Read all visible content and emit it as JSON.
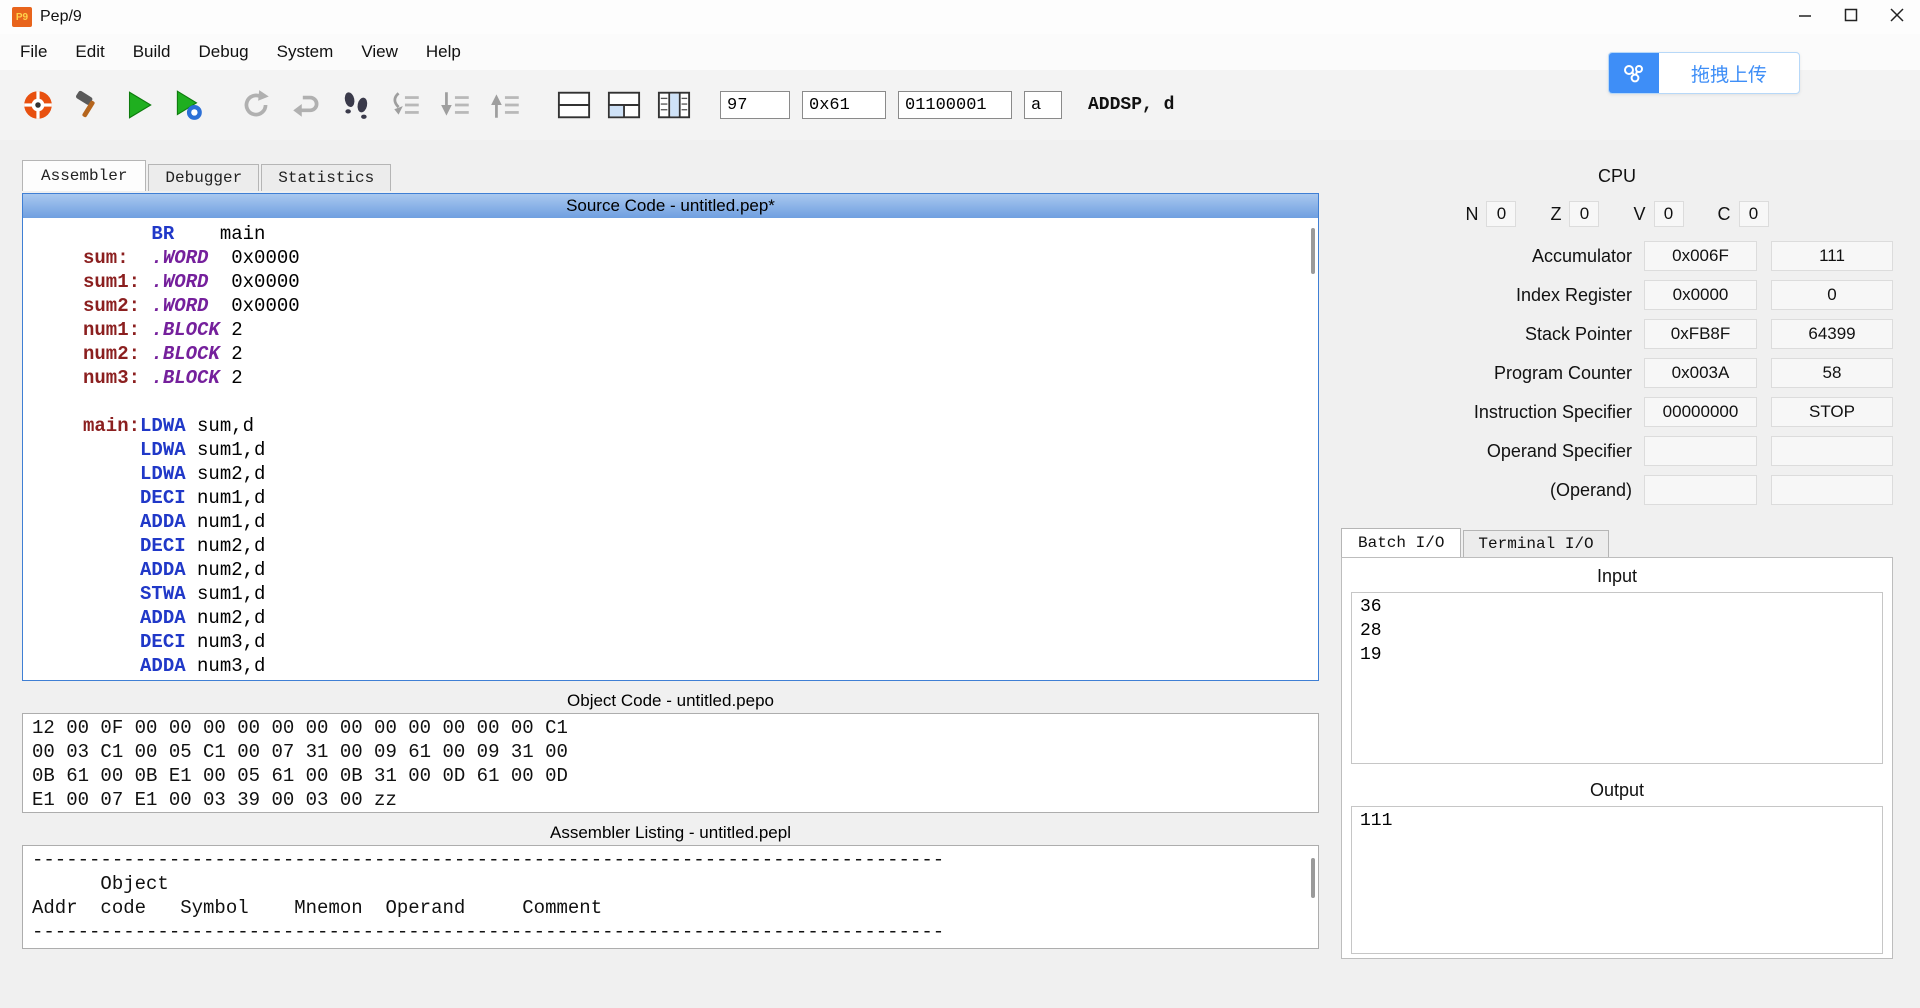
{
  "window": {
    "title": "Pep/9",
    "icon_text": "P9"
  },
  "menu": {
    "items": [
      "File",
      "Edit",
      "Build",
      "Debug",
      "System",
      "View",
      "Help"
    ]
  },
  "toolbar": {
    "converter": {
      "dec": "97",
      "hex": "0x61",
      "bin": "01100001",
      "ascii": "a",
      "mnemonic": "ADDSP, d"
    }
  },
  "overlay": {
    "upload_label": "拖拽上传"
  },
  "main_tabs": [
    "Assembler",
    "Debugger",
    "Statistics"
  ],
  "source": {
    "title": "Source Code - untitled.pep*",
    "lines": [
      [
        [
          "plain",
          "      "
        ],
        [
          "mnem",
          "BR"
        ],
        [
          "plain",
          "    "
        ],
        [
          "text",
          "main"
        ]
      ],
      [
        [
          "label",
          "sum:"
        ],
        [
          "plain",
          "  "
        ],
        [
          "dot",
          ".WORD"
        ],
        [
          "plain",
          "  "
        ],
        [
          "text",
          "0x0000"
        ]
      ],
      [
        [
          "label",
          "sum1:"
        ],
        [
          "plain",
          " "
        ],
        [
          "dot",
          ".WORD"
        ],
        [
          "plain",
          "  "
        ],
        [
          "text",
          "0x0000"
        ]
      ],
      [
        [
          "label",
          "sum2:"
        ],
        [
          "plain",
          " "
        ],
        [
          "dot",
          ".WORD"
        ],
        [
          "plain",
          "  "
        ],
        [
          "text",
          "0x0000"
        ]
      ],
      [
        [
          "label",
          "num1:"
        ],
        [
          "plain",
          " "
        ],
        [
          "dot",
          ".BLOCK"
        ],
        [
          "plain",
          " "
        ],
        [
          "text",
          "2"
        ]
      ],
      [
        [
          "label",
          "num2:"
        ],
        [
          "plain",
          " "
        ],
        [
          "dot",
          ".BLOCK"
        ],
        [
          "plain",
          " "
        ],
        [
          "text",
          "2"
        ]
      ],
      [
        [
          "label",
          "num3:"
        ],
        [
          "plain",
          " "
        ],
        [
          "dot",
          ".BLOCK"
        ],
        [
          "plain",
          " "
        ],
        [
          "text",
          "2"
        ]
      ],
      [],
      [
        [
          "label",
          "main:"
        ],
        [
          "mnem",
          "LDWA"
        ],
        [
          "plain",
          " "
        ],
        [
          "text",
          "sum,d"
        ]
      ],
      [
        [
          "plain",
          "     "
        ],
        [
          "mnem",
          "LDWA"
        ],
        [
          "plain",
          " "
        ],
        [
          "text",
          "sum1,d"
        ]
      ],
      [
        [
          "plain",
          "     "
        ],
        [
          "mnem",
          "LDWA"
        ],
        [
          "plain",
          " "
        ],
        [
          "text",
          "sum2,d"
        ]
      ],
      [
        [
          "plain",
          "     "
        ],
        [
          "mnem",
          "DECI"
        ],
        [
          "plain",
          " "
        ],
        [
          "text",
          "num1,d"
        ]
      ],
      [
        [
          "plain",
          "     "
        ],
        [
          "mnem",
          "ADDA"
        ],
        [
          "plain",
          " "
        ],
        [
          "text",
          "num1,d"
        ]
      ],
      [
        [
          "plain",
          "     "
        ],
        [
          "mnem",
          "DECI"
        ],
        [
          "plain",
          " "
        ],
        [
          "text",
          "num2,d"
        ]
      ],
      [
        [
          "plain",
          "     "
        ],
        [
          "mnem",
          "ADDA"
        ],
        [
          "plain",
          " "
        ],
        [
          "text",
          "num2,d"
        ]
      ],
      [
        [
          "plain",
          "     "
        ],
        [
          "mnem",
          "STWA"
        ],
        [
          "plain",
          " "
        ],
        [
          "text",
          "sum1,d"
        ]
      ],
      [
        [
          "plain",
          "     "
        ],
        [
          "mnem",
          "ADDA"
        ],
        [
          "plain",
          " "
        ],
        [
          "text",
          "num2,d"
        ]
      ],
      [
        [
          "plain",
          "     "
        ],
        [
          "mnem",
          "DECI"
        ],
        [
          "plain",
          " "
        ],
        [
          "text",
          "num3,d"
        ]
      ],
      [
        [
          "plain",
          "     "
        ],
        [
          "mnem",
          "ADDA"
        ],
        [
          "plain",
          " "
        ],
        [
          "text",
          "num3,d"
        ]
      ]
    ]
  },
  "object_code": {
    "title": "Object Code - untitled.pepo",
    "lines": [
      "12 00 0F 00 00 00 00 00 00 00 00 00 00 00 00 C1",
      "00 03 C1 00 05 C1 00 07 31 00 09 61 00 09 31 00",
      "0B 61 00 0B E1 00 05 61 00 0B 31 00 0D 61 00 0D",
      "E1 00 07 E1 00 03 39 00 03 00 zz"
    ]
  },
  "listing": {
    "title": "Assembler Listing - untitled.pepl",
    "lines": [
      "--------------------------------------------------------------------------------",
      "      Object",
      "Addr  code   Symbol    Mnemon  Operand     Comment",
      "--------------------------------------------------------------------------------"
    ]
  },
  "cpu": {
    "title": "CPU",
    "flags": [
      {
        "label": "N",
        "value": "0"
      },
      {
        "label": "Z",
        "value": "0"
      },
      {
        "label": "V",
        "value": "0"
      },
      {
        "label": "C",
        "value": "0"
      }
    ],
    "registers": [
      {
        "label": "Accumulator",
        "hex": "0x006F",
        "dec": "111"
      },
      {
        "label": "Index Register",
        "hex": "0x0000",
        "dec": "0"
      },
      {
        "label": "Stack Pointer",
        "hex": "0xFB8F",
        "dec": "64399"
      },
      {
        "label": "Program Counter",
        "hex": "0x003A",
        "dec": "58"
      },
      {
        "label": "Instruction Specifier",
        "hex": "00000000",
        "dec": "STOP"
      },
      {
        "label": "Operand Specifier",
        "hex": "",
        "dec": ""
      },
      {
        "label": "(Operand)",
        "hex": "",
        "dec": ""
      }
    ]
  },
  "io": {
    "tabs": [
      "Batch I/O",
      "Terminal I/O"
    ],
    "input_label": "Input",
    "input_value": "36\n28\n19",
    "output_label": "Output",
    "output_value": "111"
  }
}
